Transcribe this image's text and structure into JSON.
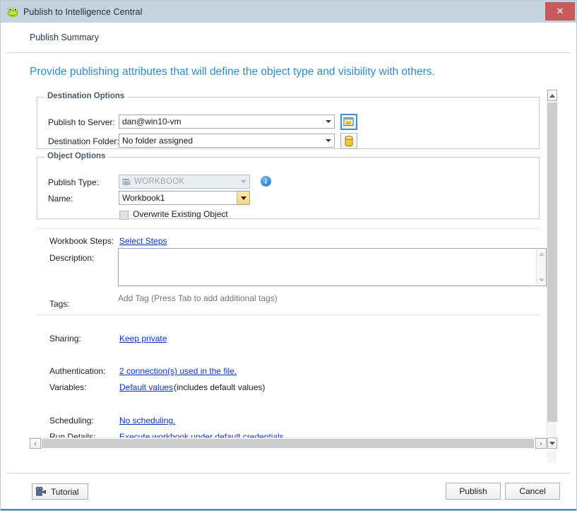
{
  "window": {
    "title": "Publish to Intelligence Central",
    "title_icon": "toad-frog-icon",
    "close_label": "✕",
    "accent_color": "#2e8bc9",
    "titlebar_color": "#c3d4e0",
    "close_button_color": "#c75a5a"
  },
  "header": {
    "title": "Publish Summary"
  },
  "subtitle": "Provide publishing attributes that will define the object type and visibility with others.",
  "destination_options": {
    "legend": "Destination Options",
    "publish_to_server": {
      "label": "Publish to Server:",
      "value": "dan@win10-vm",
      "button_icon": "new-server-connection-icon"
    },
    "destination_folder": {
      "label": "Destination Folder:",
      "value": "No folder assigned",
      "button_icon": "database-cylinder-icon"
    }
  },
  "object_options": {
    "legend": "Object Options",
    "publish_type": {
      "label": "Publish Type:",
      "value": "WORKBOOK",
      "icon": "workbook-icon",
      "disabled": true,
      "info_icon": "info-icon",
      "info_glyph": "i"
    },
    "name": {
      "label": "Name:",
      "value": "Workbook1"
    },
    "overwrite": {
      "label": "Overwrite Existing Object",
      "checked": false,
      "disabled": true
    }
  },
  "details": {
    "workbook_steps": {
      "label": "Workbook Steps:",
      "link": "Select Steps"
    },
    "description": {
      "label": "Description:",
      "value": ""
    },
    "tags": {
      "label": "Tags:",
      "value": "",
      "placeholder": "Add Tag (Press Tab to add additional tags)"
    },
    "sharing": {
      "label": "Sharing:",
      "link": "Keep private"
    },
    "authentication": {
      "label": "Authentication:",
      "link": "2 connection(s) used in the file."
    },
    "variables": {
      "label": "Variables:",
      "link": "Default values",
      "suffix": "(includes default values)"
    },
    "scheduling": {
      "label": "Scheduling:",
      "link": "No scheduling."
    },
    "run_details": {
      "label": "Run Details:",
      "link": "Execute workbook under default credentials"
    }
  },
  "scrollbars": {
    "vertical": {
      "up": "▲",
      "down": "▼"
    },
    "horizontal": {
      "left": "‹",
      "right": "›"
    }
  },
  "footer": {
    "tutorial": {
      "label": "Tutorial",
      "icon": "movie-camera-icon"
    },
    "publish": "Publish",
    "cancel": "Cancel"
  }
}
